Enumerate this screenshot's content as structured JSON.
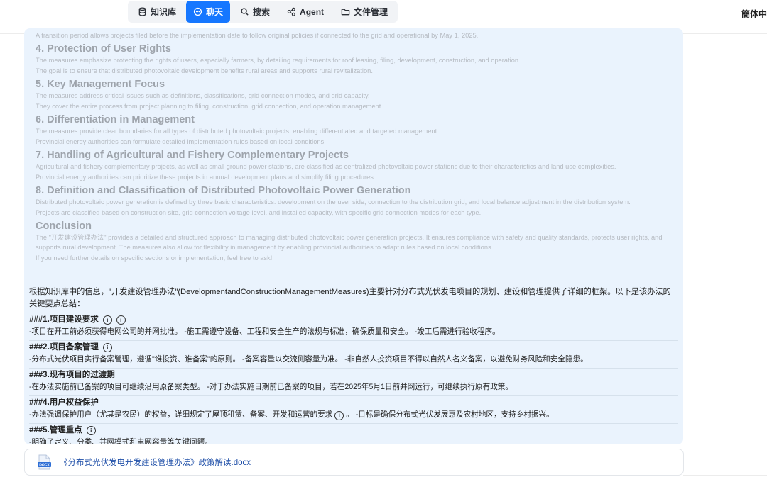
{
  "nav": {
    "items": [
      {
        "label": "知识库",
        "icon": "database-icon",
        "active": false
      },
      {
        "label": "聊天",
        "icon": "chat-icon",
        "active": true
      },
      {
        "label": "搜索",
        "icon": "search-icon",
        "active": false
      },
      {
        "label": "Agent",
        "icon": "agent-icon",
        "active": false
      },
      {
        "label": "文件管理",
        "icon": "folder-icon",
        "active": false
      }
    ],
    "language": "簡体中"
  },
  "faded": {
    "s3_tail": "A transition period allows projects filed before the implementation date to follow original policies if connected to the grid and operational by May 1, 2025.",
    "s4_title": "4. Protection of User Rights",
    "s4_l1": "The measures emphasize protecting the rights of users, especially farmers, by detailing requirements for roof leasing, filing, development, construction, and operation.",
    "s4_l2": "The goal is to ensure that distributed photovoltaic development benefits rural areas and supports rural revitalization.",
    "s5_title": "5. Key Management Focus",
    "s5_l1": "The measures address critical issues such as definitions, classifications, grid connection modes, and grid capacity.",
    "s5_l2": "They cover the entire process from project planning to filing, construction, grid connection, and operation management.",
    "s6_title": "6. Differentiation in Management",
    "s6_l1": "The measures provide clear boundaries for all types of distributed photovoltaic projects, enabling differentiated and targeted management.",
    "s6_l2": "Provincial energy authorities can formulate detailed implementation rules based on local conditions.",
    "s7_title": "7. Handling of Agricultural and Fishery Complementary Projects",
    "s7_l1": "Agricultural and fishery complementary projects, as well as small ground power stations, are classified as centralized photovoltaic power stations due to their characteristics and land use complexities.",
    "s7_l2": "Provincial energy authorities can prioritize these projects in annual development plans and simplify filing procedures.",
    "s8_title": "8. Definition and Classification of Distributed Photovoltaic Power Generation",
    "s8_l1": "Distributed photovoltaic power generation is defined by three basic characteristics: development on the user side, connection to the distribution grid, and local balance adjustment in the distribution system.",
    "s8_l2": "Projects are classified based on construction site, grid connection voltage level, and installed capacity, with specific grid connection modes for each type.",
    "conclusion_title": "Conclusion",
    "conclusion_l1": "The \"开发建设管理办法\" provides a detailed and structured approach to managing distributed photovoltaic power generation projects. It ensures compliance with safety and quality standards, protects user rights, and supports rural development. The measures also allow for flexibility in management by enabling provincial authorities to adapt rules based on local conditions.",
    "conclusion_l2": "If you need further details on specific sections or implementation, feel free to ask!"
  },
  "answer": {
    "intro": "根据知识库中的信息，\"开发建设管理办法\"(DevelopmentandConstructionManagementMeasures)主要针对分布式光伏发电项目的规划、建设和管理提供了详细的框架。以下是该办法的关键要点总结：",
    "sections": [
      {
        "title": "###1.项目建设要求",
        "icons": 2,
        "body": "-项目在开工前必须获得电网公司的并网批准。 -施工需遵守设备、工程和安全生产的法规与标准，确保质量和安全。 -竣工后需进行验收程序。"
      },
      {
        "title": "###2.项目备案管理",
        "icons": 1,
        "body": "-分布式光伏项目实行备案管理，遵循\"谁投资、谁备案\"的原则。 -备案容量以交流侧容量为准。 -非自然人投资项目不得以自然人名义备案，以避免财务风险和安全隐患。"
      },
      {
        "title": "###3.现有项目的过渡期",
        "icons": 0,
        "body": "-在办法实施前已备案的项目可继续沿用原备案类型。 -对于办法实施日期前已备案的项目，若在2025年5月1日前并网运行，可继续执行原有政策。"
      },
      {
        "title": "###4.用户权益保护",
        "icons": 0,
        "body_a": "-办法强调保护用户（尤其是农民）的权益，详细规定了屋顶租赁、备案、开发和运营的要求",
        "body_b": "。 -目标是确保分布式光伏发展惠及农村地区，支持乡村振兴。"
      },
      {
        "title": "###5.管理重点",
        "icons": 1,
        "body": "-明确了定义、分类、并网模式和电网容量等关键问题。"
      }
    ],
    "info_glyph": "i"
  },
  "attachment": {
    "name": "《分布式光伏发电开发建设管理办法》政策解读.docx",
    "icon_label": "DOCX"
  }
}
